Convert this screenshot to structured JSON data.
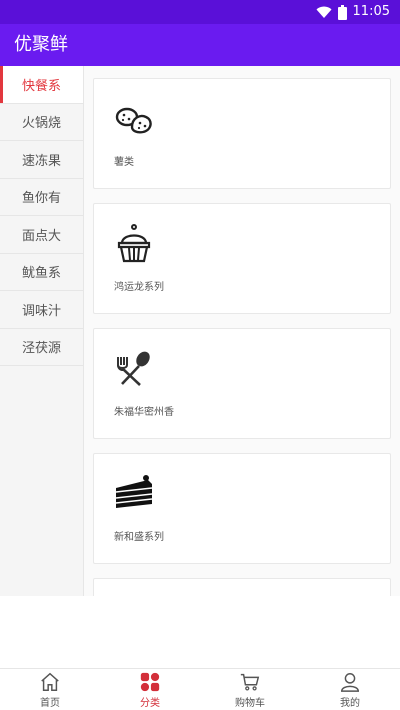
{
  "status": {
    "time": "11:05",
    "wifi_icon": "wifi-icon",
    "battery_icon": "battery-icon"
  },
  "app": {
    "title": "优聚鲜"
  },
  "sidebar": {
    "items": [
      {
        "label": "快餐系",
        "active": true
      },
      {
        "label": "火锅烧"
      },
      {
        "label": "速冻果"
      },
      {
        "label": "鱼你有"
      },
      {
        "label": "面点大"
      },
      {
        "label": "鱿鱼系"
      },
      {
        "label": "调味汁"
      },
      {
        "label": "泾茯源"
      }
    ]
  },
  "categories": [
    {
      "label": "薯类",
      "icon": "potato-icon"
    },
    {
      "label": "鸿运龙系列",
      "icon": "cupcake-icon"
    },
    {
      "label": "朱福华密州香",
      "icon": "utensils-icon"
    },
    {
      "label": "新和盛系列",
      "icon": "cake-slice-icon"
    }
  ],
  "nav": {
    "items": [
      {
        "label": "首页",
        "icon": "home-icon"
      },
      {
        "label": "分类",
        "icon": "category-icon",
        "active": true
      },
      {
        "label": "购物车",
        "icon": "cart-icon"
      },
      {
        "label": "我的",
        "icon": "user-icon"
      }
    ]
  },
  "colors": {
    "appbar": "#6a1bf0",
    "statusbar": "#5a10d8",
    "accent": "#e2373e"
  }
}
